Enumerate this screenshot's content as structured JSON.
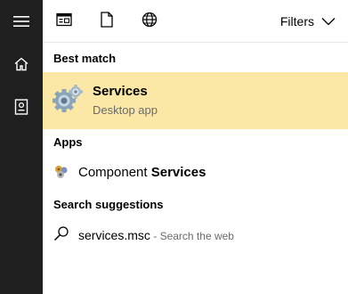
{
  "rail": {
    "items": [
      {
        "icon": "hamburger-menu-icon"
      },
      {
        "icon": "home-icon"
      },
      {
        "icon": "notebook-icon"
      }
    ]
  },
  "topbar": {
    "icons": [
      "apps-filter-icon",
      "documents-filter-icon",
      "web-filter-icon"
    ],
    "filters_label": "Filters"
  },
  "best_match": {
    "header": "Best match",
    "title": "Services",
    "subtitle": "Desktop app",
    "icon": "services-gears-icon",
    "highlight_color": "#fbe8a6"
  },
  "apps": {
    "header": "Apps",
    "items": [
      {
        "prefix": "Component ",
        "match": "Services",
        "icon": "component-services-icon"
      }
    ]
  },
  "suggestions": {
    "header": "Search suggestions",
    "items": [
      {
        "query": "services.msc",
        "separator": " - ",
        "hint": "Search the web",
        "icon": "search-icon"
      }
    ]
  },
  "colors": {
    "rail_background": "#1f1f1f",
    "content_background": "#ffffff",
    "secondary_text": "#6a6a6a"
  }
}
